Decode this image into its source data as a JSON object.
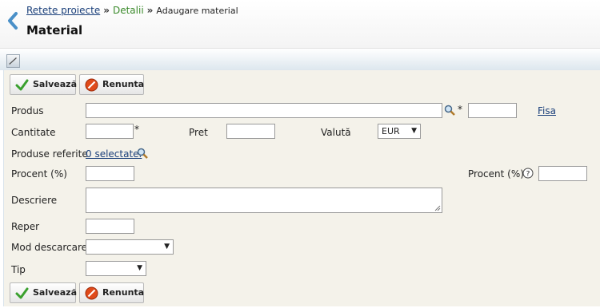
{
  "breadcrumb": {
    "item1": "Retete proiecte",
    "sep": "»",
    "item2": "Detalii",
    "item3": "Adaugare material"
  },
  "page_title": "Material",
  "toolbar": {
    "save_label": "Salvează",
    "cancel_label": "Renunta"
  },
  "form": {
    "produs_label": "Produs",
    "required_mark": "*",
    "fisa_link": "Fisa",
    "cantitate_label": "Cantitate",
    "pret_label": "Pret",
    "valuta_label": "Valută",
    "valuta_value": "EUR",
    "produse_referite_label": "Produse referite",
    "produse_referite_link": "0 selectate.",
    "procent_label": "Procent (%)",
    "procent2_label": "Procent (%)",
    "descriere_label": "Descriere",
    "reper_label": "Reper",
    "mod_descarcare_label": "Mod descarcare",
    "tip_label": "Tip",
    "dropdown_arrow": "▼",
    "help_glyph": "?"
  },
  "colors": {
    "link": "#1a3f7a",
    "breadcrumb_green": "#3a8a2a",
    "form_bg": "#f4f2ea"
  }
}
